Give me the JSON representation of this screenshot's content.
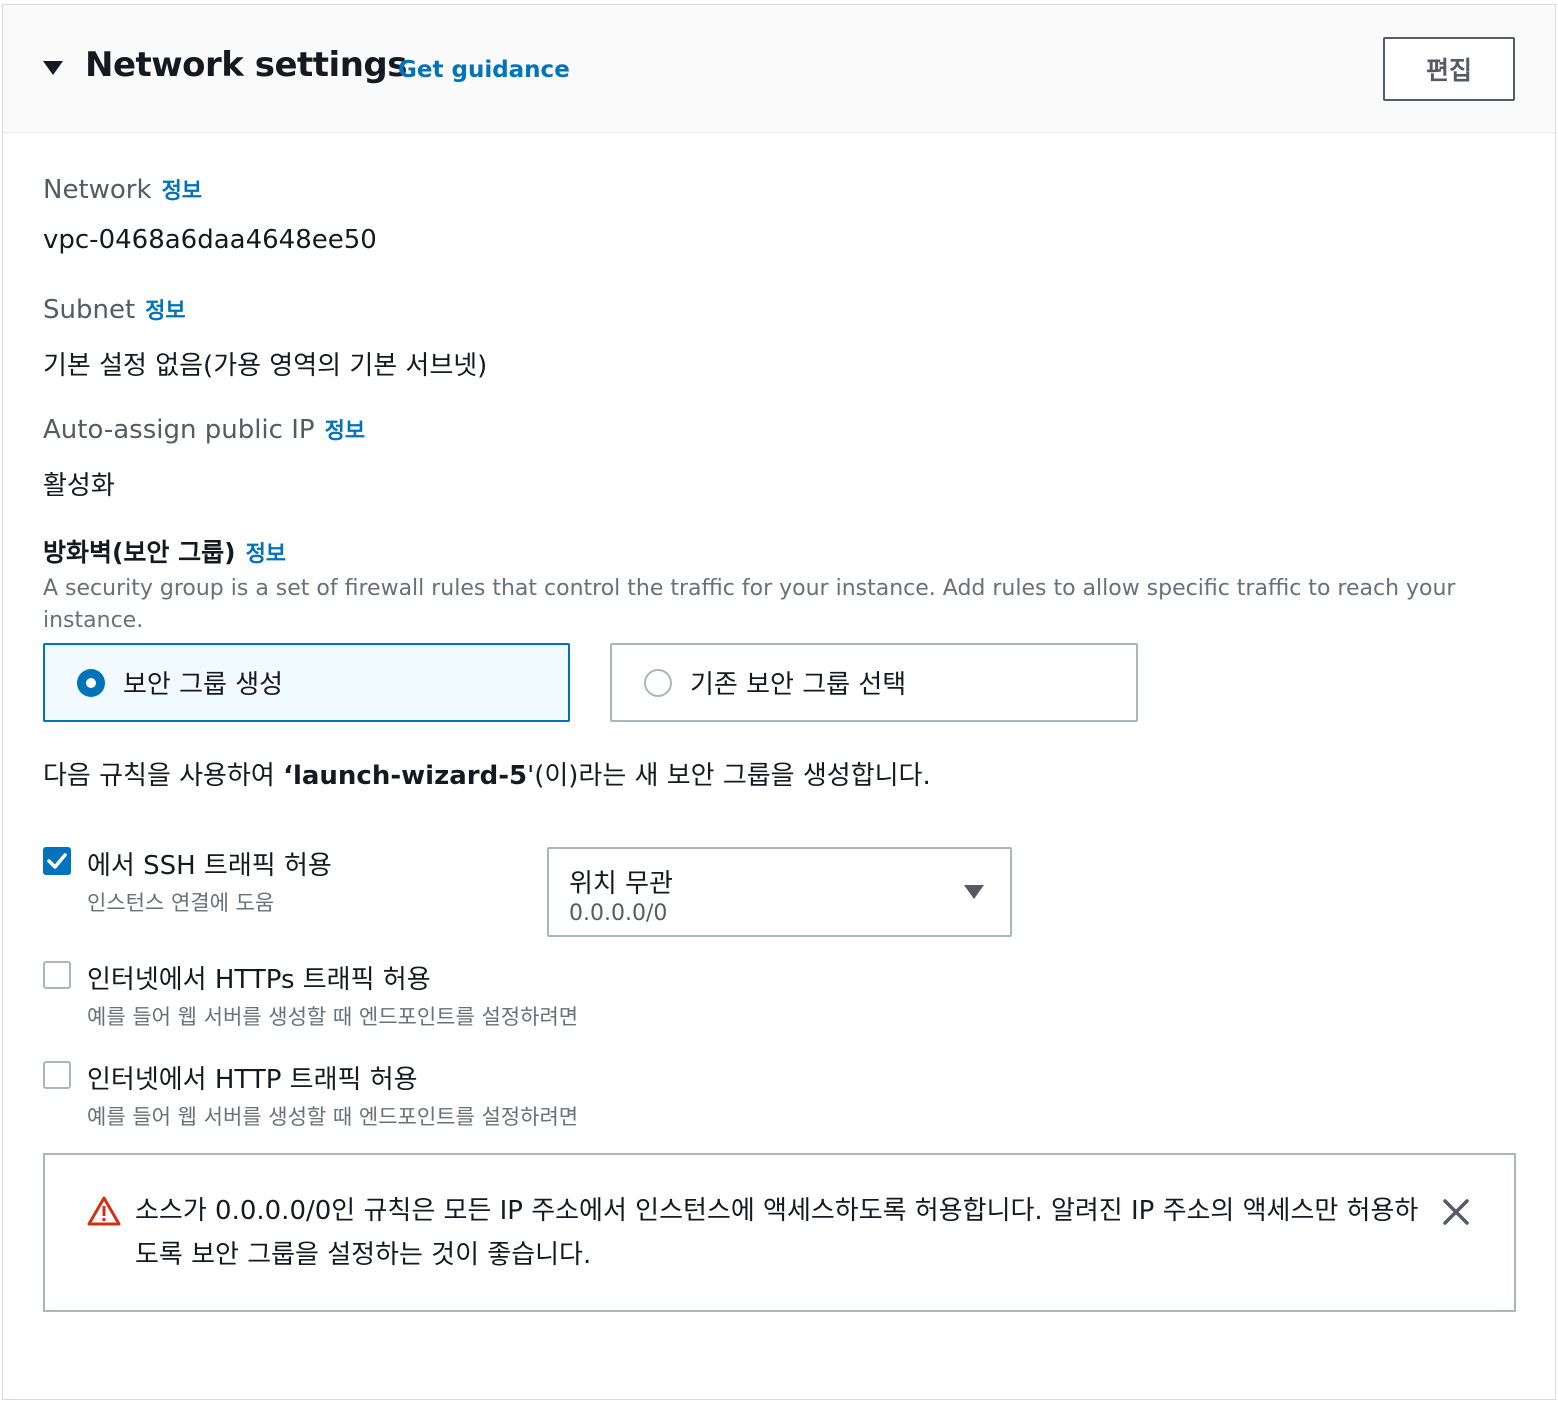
{
  "header": {
    "title": "Network settings",
    "guidance_link": "Get guidance",
    "edit_button": "편집"
  },
  "network": {
    "label": "Network",
    "info": "정보",
    "value": "vpc-0468a6daa4648ee50"
  },
  "subnet": {
    "label": "Subnet",
    "info": "정보",
    "value": "기본 설정 없음(가용 영역의 기본 서브넷)"
  },
  "public_ip": {
    "label": "Auto-assign public IP",
    "info": "정보",
    "value": "활성화"
  },
  "firewall": {
    "label": "방화벽(보안 그룹)",
    "info": "정보",
    "description": "A security group is a set of firewall rules that control the traffic for your instance. Add rules to allow specific traffic to reach your instance.",
    "options": [
      {
        "label": "보안 그룹 생성",
        "selected": true
      },
      {
        "label": "기존 보안 그룹 선택",
        "selected": false
      }
    ],
    "rule_prefix": "다음 규칙을 사용하여 ",
    "group_name": "‘launch-wizard-5",
    "rule_suffix": "'(이)라는 새 보안 그룹을 생성합니다."
  },
  "rules": [
    {
      "label": "에서 SSH 트래픽 허용",
      "sublabel": "인스턴스 연결에 도움",
      "checked": true
    },
    {
      "label": "인터넷에서 HTTPs 트래픽 허용",
      "sublabel": "예를 들어 웹 서버를 생성할 때 엔드포인트를 설정하려면",
      "checked": false
    },
    {
      "label": "인터넷에서 HTTP 트래픽 허용",
      "sublabel": "예를 들어 웹 서버를 생성할 때 엔드포인트를 설정하려면",
      "checked": false
    }
  ],
  "ssh_source": {
    "selected": "위치 무관",
    "detail": "0.0.0.0/0"
  },
  "warning": {
    "text": "소스가 0.0.0.0/0인 규칙은 모든 IP 주소에서 인스턴스에 액세스하도록 허용합니다. 알려진 IP 주소의 액세스만 허용하도록 보안 그룹을 설정하는 것이 좋습니다."
  },
  "colors": {
    "link": "#0073bb",
    "selected_border": "#0073bb",
    "warning": "#d13212"
  },
  "icons": [
    "caret-down-icon",
    "warning-icon",
    "close-icon",
    "checkmark-icon",
    "select-caret-icon"
  ]
}
